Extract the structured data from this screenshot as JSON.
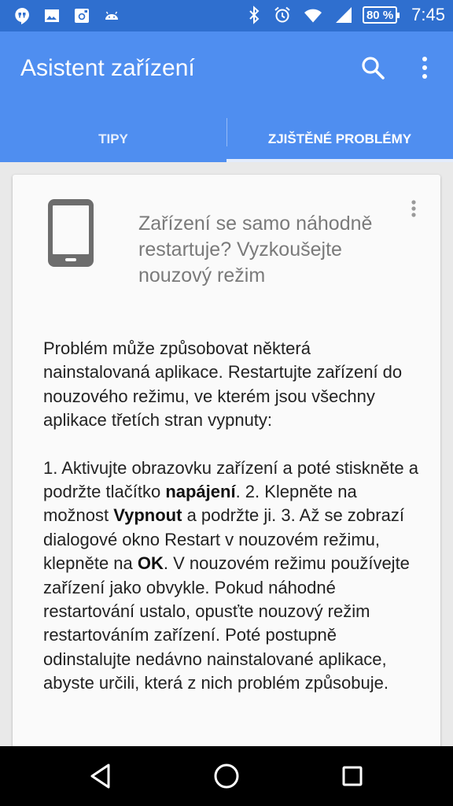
{
  "status_bar": {
    "left_icons": [
      "hangouts-icon",
      "image-icon",
      "instagram-icon",
      "android-icon"
    ],
    "right_icons": [
      "bluetooth-icon",
      "alarm-icon",
      "wifi-icon",
      "signal-icon",
      "battery-icon"
    ],
    "battery": "80 %",
    "time": "7:45",
    "background": "#2f6fcf"
  },
  "app_bar": {
    "title": "Asistent zařízení",
    "icons": [
      "search-icon",
      "more-vert-icon"
    ],
    "background": "#4f8ef0"
  },
  "tabs": [
    {
      "label": "TIPY",
      "active": false
    },
    {
      "label": "ZJIŠTĚNÉ PROBLÉMY",
      "active": true
    }
  ],
  "card": {
    "icon": "smartphone-icon",
    "title": "Zařízení se samo náhodně restartuje? Vyzkoušejte nouzový režim",
    "intro": "Problém může způsobovat některá nainstalovaná aplikace. Restartujte zařízení do nouzového režimu, ve kterém jsou všechny aplikace třetích stran vypnuty:",
    "steps": {
      "t1": "1. Aktivujte obrazovku zařízení a poté stiskněte a podržte tlačítko ",
      "b1": "napájení",
      "t2": ". 2. Klepněte na možnost ",
      "b2": "Vypnout",
      "t3": " a podržte ji. 3. Až se zobrazí dialogové okno Restart v nouzovém režimu, klepněte na ",
      "b3": "OK",
      "t4": ". V nouzovém režimu používejte zařízení jako obvykle. Pokud náhodné restartování ustalo, opusťte nouzový režim restartováním zařízení. Poté postupně odinstalujte nedávno nainstalované aplikace, abyste určili, která z nich problém způsobuje."
    }
  },
  "nav_bar": {
    "icons": [
      "back-icon",
      "home-icon",
      "recents-icon"
    ]
  }
}
